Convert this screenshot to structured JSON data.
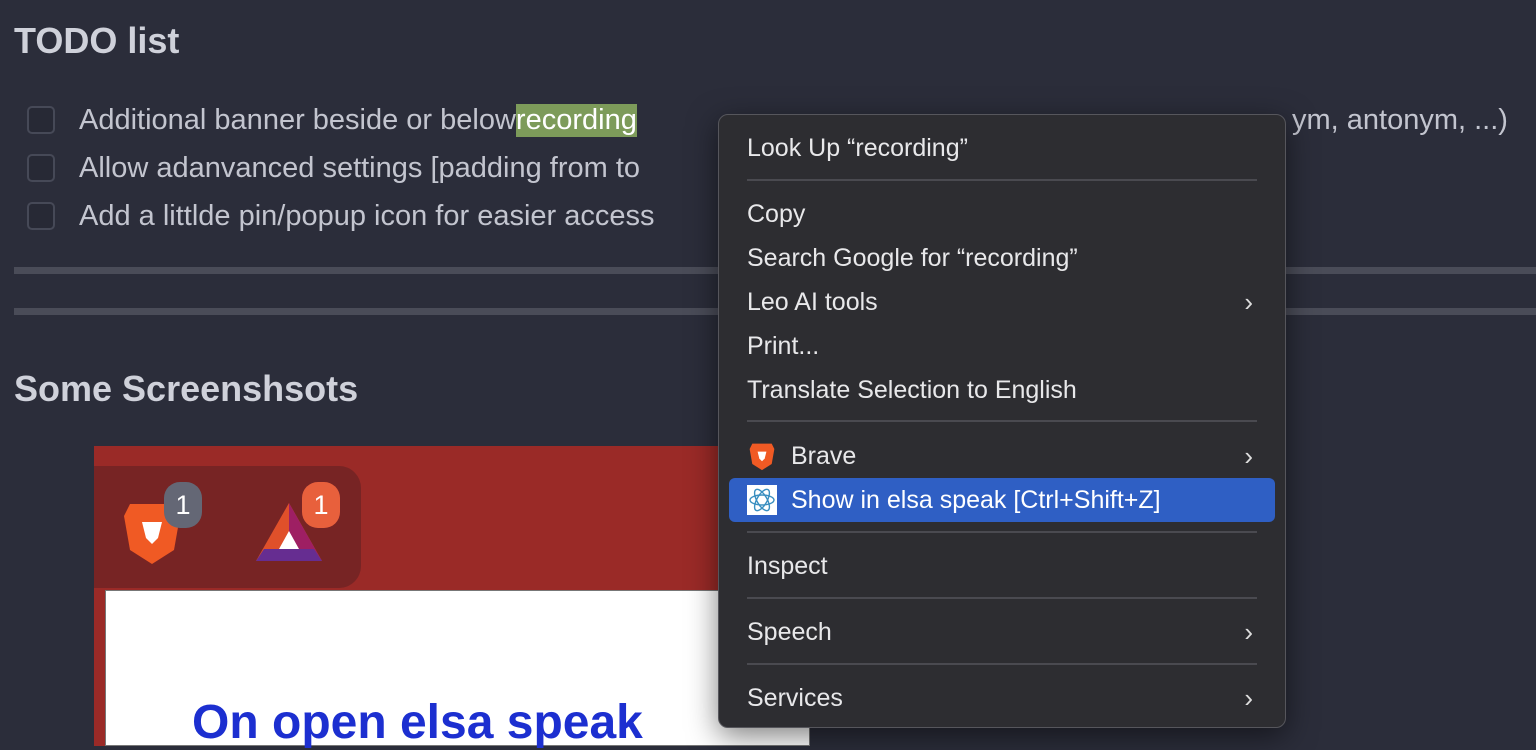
{
  "todo": {
    "title": "TODO list",
    "items": [
      {
        "before": "Additional banner beside or below ",
        "highlight": "recording",
        "after": "ym, antonym, ...)"
      },
      {
        "text": "Allow adanvanced settings [padding from to"
      },
      {
        "text": "Add a littlde pin/popup icon for easier access"
      }
    ]
  },
  "screens": {
    "title": "Some Screenshsots",
    "badge1": "1",
    "badge2": "1",
    "heading": "On open elsa speak"
  },
  "menu": {
    "items": [
      "Look Up “recording”",
      "Copy",
      "Search Google for “recording”",
      "Leo AI tools",
      "Print...",
      "Translate Selection to English",
      "Brave",
      "Show in elsa speak [Ctrl+Shift+Z]",
      "Inspect",
      "Speech",
      "Services"
    ],
    "chevron": "›"
  },
  "colors": {
    "highlight": "#7d9b5a",
    "selected": "#2f5fc4",
    "brave": "#f05a24"
  }
}
